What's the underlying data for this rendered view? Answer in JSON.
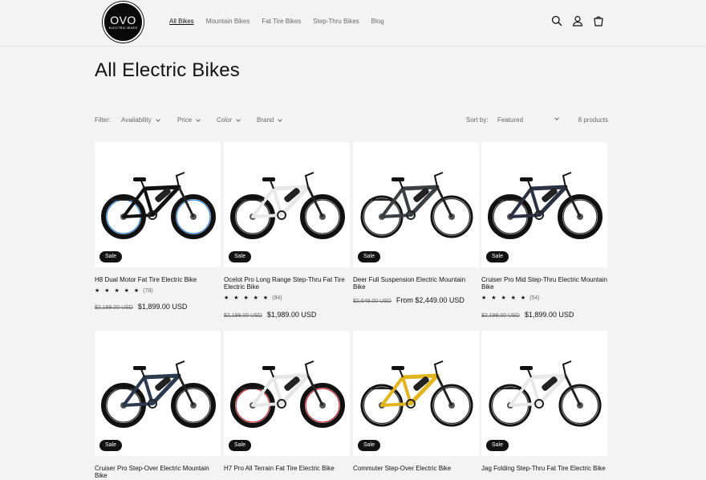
{
  "header": {
    "logo_main": "OVO",
    "logo_sub": "ELECTRIC BIKES",
    "nav": [
      "All Bikes",
      "Mountain Bikes",
      "Fat Tire Bikes",
      "Step-Thru Bikes",
      "Blog"
    ],
    "icons": [
      "search-icon",
      "account-icon",
      "cart-icon"
    ]
  },
  "page": {
    "title": "All Electric Bikes"
  },
  "filters": {
    "label": "Filter:",
    "items": [
      "Availability",
      "Price",
      "Color",
      "Brand"
    ],
    "sort_label": "Sort by:",
    "sort_value": "Featured",
    "count": "8 products"
  },
  "products": [
    {
      "name": "H8 Dual Motor Fat Tire Electric Bike",
      "badge": "Sale",
      "stars": "★ ★ ★ ★ ★",
      "reviews": "(78)",
      "old_price": "$2,199.00 USD",
      "price": "$1,899.00 USD",
      "frame": "#111111",
      "accent": "#2e7fd1"
    },
    {
      "name": "Ocelot Pro Long Range Step-Thru Fat Tire Electric Bike",
      "badge": "Sale",
      "stars": "★ ★ ★ ★ ★",
      "reviews": "(84)",
      "old_price": "$2,199.00 USD",
      "price": "$1,989.00 USD",
      "frame": "#e8e8e8",
      "accent": "#111111"
    },
    {
      "name": "Deer Full Suspension Electric Mountain Bike",
      "badge": "Sale",
      "stars": "",
      "reviews": "",
      "old_price": "$2,649.00 USD",
      "price": "From $2,449.00 USD",
      "frame": "#3b3f44",
      "accent": "#111111"
    },
    {
      "name": "Cruiser Pro Mid Step-Thru Electric Mountain Bike",
      "badge": "Sale",
      "stars": "★ ★ ★ ★ ★",
      "reviews": "(54)",
      "old_price": "$2,199.00 USD",
      "price": "$1,899.00 USD",
      "frame": "#2a3142",
      "accent": "#111111"
    },
    {
      "name": "Cruiser Pro Step-Over Electric Mountain Bike",
      "badge": "Sale",
      "frame": "#2c3a4f",
      "accent": "#111111"
    },
    {
      "name": "H7 Pro All Terrain Fat Tire Electric Bike",
      "badge": "Sale",
      "frame": "#e6e6e6",
      "accent": "#c4202a"
    },
    {
      "name": "Commuter Step-Over Electric Bike",
      "badge": "Sale",
      "frame": "#e2b51f",
      "accent": "#111111"
    },
    {
      "name": "Jag Folding Step-Thru Fat Tire Electric Bike",
      "badge": "Sale",
      "frame": "#e8e8e8",
      "accent": "#111111"
    }
  ]
}
